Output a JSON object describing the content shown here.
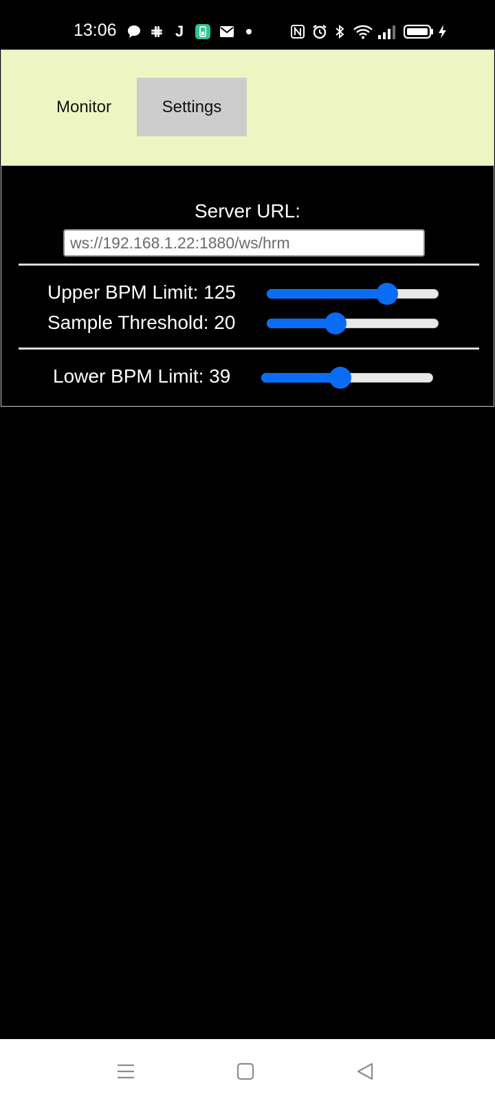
{
  "status_bar": {
    "time": "13:06",
    "icons": [
      "chat-icon",
      "slack-icon",
      "j-app-icon",
      "battery-app-icon",
      "mail-icon",
      "dot-icon",
      "nfc-icon",
      "alarm-icon",
      "bluetooth-icon",
      "wifi-icon",
      "signal-icon",
      "battery-icon",
      "charging-icon"
    ]
  },
  "tabs": {
    "monitor": "Monitor",
    "settings": "Settings",
    "active": "Settings"
  },
  "settings": {
    "server_url_label": "Server URL:",
    "server_url_placeholder": "ws://192.168.1.22:1880/ws/hrm",
    "upper_label": "Upper BPM Limit: 125",
    "upper_fraction": 0.7,
    "threshold_label": "Sample Threshold: 20",
    "threshold_fraction": 0.4,
    "lower_label": "Lower BPM Limit: 39",
    "lower_fraction": 0.46
  },
  "nav": {
    "icons": [
      "menu-icon",
      "home-icon",
      "back-icon"
    ]
  },
  "colors": {
    "header_bg": "#edf5c2",
    "active_tab_bg": "#cdcdcd",
    "slider_accent": "#0a6cf5",
    "panel_bg": "#000000"
  }
}
